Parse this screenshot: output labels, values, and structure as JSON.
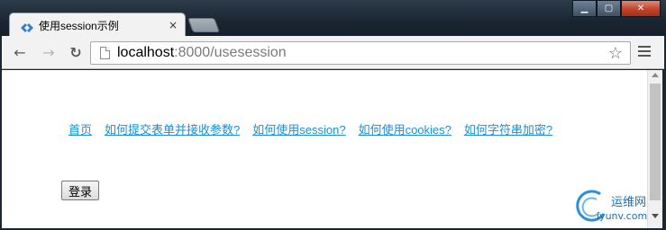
{
  "window": {
    "tab_title": "使用session示例",
    "tab_close": "×",
    "minimize": "▁",
    "maximize": "▢",
    "close": "✕"
  },
  "toolbar": {
    "back_icon": "←",
    "forward_icon": "→",
    "reload_icon": "↻",
    "url_host": "localhost",
    "url_rest": ":8000/usesession",
    "star_icon": "☆"
  },
  "page": {
    "nav_links": [
      {
        "label": "首页"
      },
      {
        "label": "如何提交表单并接收参数?"
      },
      {
        "label": "如何使用session?"
      },
      {
        "label": "如何使用cookies?"
      },
      {
        "label": "如何字符串加密?"
      }
    ],
    "login_button": "登录"
  },
  "watermark": {
    "text1": "运维网",
    "text2": "iyunv.com"
  },
  "colors": {
    "link": "#1a8fd6",
    "watermark": "#1a6fb0"
  }
}
